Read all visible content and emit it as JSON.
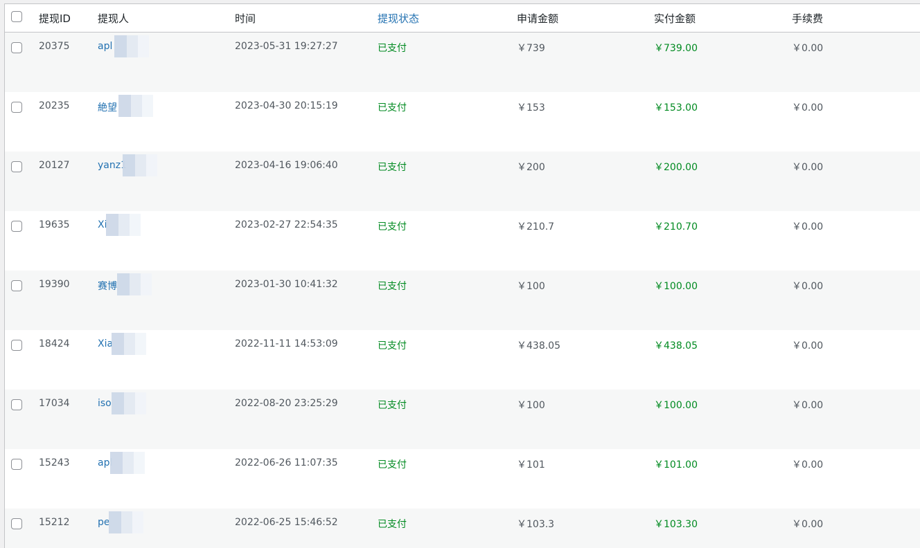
{
  "columns": {
    "id": "提现ID",
    "user": "提现人",
    "time": "时间",
    "status": "提现状态",
    "apply": "申请金额",
    "paid": "实付金额",
    "fee": "手续费"
  },
  "rows": [
    {
      "id": "20375",
      "user": "apl",
      "time": "2023-05-31 19:27:27",
      "status": "已支付",
      "apply": "￥739",
      "paid": "￥739.00",
      "fee": "￥0.00"
    },
    {
      "id": "20235",
      "user": "絶望",
      "time": "2023-04-30 20:15:19",
      "status": "已支付",
      "apply": "￥153",
      "paid": "￥153.00",
      "fee": "￥0.00"
    },
    {
      "id": "20127",
      "user": "yanz1",
      "time": "2023-04-16 19:06:40",
      "status": "已支付",
      "apply": "￥200",
      "paid": "￥200.00",
      "fee": "￥0.00"
    },
    {
      "id": "19635",
      "user": "Xi",
      "time": "2023-02-27 22:54:35",
      "status": "已支付",
      "apply": "￥210.7",
      "paid": "￥210.70",
      "fee": "￥0.00"
    },
    {
      "id": "19390",
      "user": "赛博",
      "time": "2023-01-30 10:41:32",
      "status": "已支付",
      "apply": "￥100",
      "paid": "￥100.00",
      "fee": "￥0.00"
    },
    {
      "id": "18424",
      "user": "Xia",
      "time": "2022-11-11 14:53:09",
      "status": "已支付",
      "apply": "￥438.05",
      "paid": "￥438.05",
      "fee": "￥0.00"
    },
    {
      "id": "17034",
      "user": "iso",
      "time": "2022-08-20 23:25:29",
      "status": "已支付",
      "apply": "￥100",
      "paid": "￥100.00",
      "fee": "￥0.00"
    },
    {
      "id": "15243",
      "user": "apl",
      "time": "2022-06-26 11:07:35",
      "status": "已支付",
      "apply": "￥101",
      "paid": "￥101.00",
      "fee": "￥0.00"
    },
    {
      "id": "15212",
      "user": "pe",
      "time": "2022-06-25 15:46:52",
      "status": "已支付",
      "apply": "￥103.3",
      "paid": "￥103.30",
      "fee": "￥0.00"
    }
  ],
  "colors": {
    "link": "#2271b1",
    "paid_green": "#008a20",
    "row_alt": "#f6f7f7"
  }
}
